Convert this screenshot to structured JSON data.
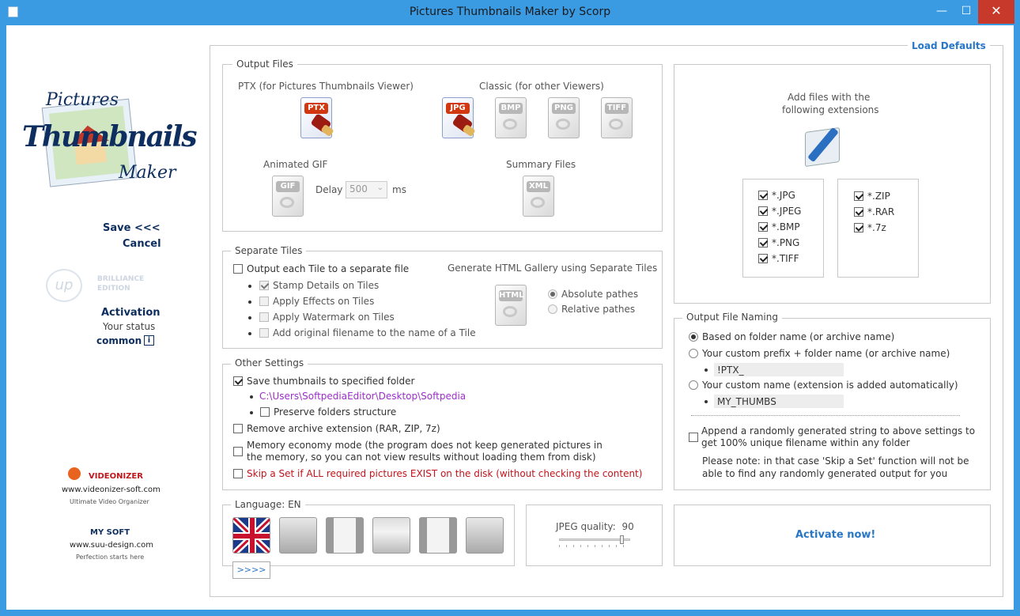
{
  "window": {
    "title": "Pictures Thumbnails Maker by Scorp",
    "min": "—",
    "max": "☐",
    "close": "✕"
  },
  "sidebar": {
    "logo_line1": "Pictures",
    "logo_line2": "Thumbnails",
    "logo_line3": "Maker",
    "save": "Save <<<",
    "cancel": "Cancel",
    "brilliance_line1": "BRILLIANCE",
    "brilliance_line2": "EDITION",
    "activation": "Activation",
    "your_status": "Your status",
    "status_value": "common",
    "videonizer": {
      "name": "VIDEONIZER",
      "url": "www.videonizer-soft.com",
      "tagline": "Ultimate Video Organizer"
    },
    "mysoft": {
      "name": "MY SOFT",
      "url": "www.suu-design.com",
      "tagline": "Perfection starts here"
    }
  },
  "load_defaults": "Load Defaults",
  "output_files": {
    "legend": "Output Files",
    "ptx_label": "PTX (for Pictures Thumbnails Viewer)",
    "classic_label": "Classic (for other Viewers)",
    "icons": [
      "PTX",
      "JPG",
      "BMP",
      "PNG",
      "TIFF"
    ],
    "animated_gif": "Animated GIF",
    "gif_icon": "GIF",
    "delay_label": "Delay",
    "delay_value": "500",
    "delay_unit": "ms",
    "summary_files": "Summary Files",
    "xml_icon": "XML"
  },
  "extensions": {
    "title_line1": "Add files with the",
    "title_line2": "following extensions",
    "left": [
      {
        "label": "*.JPG",
        "checked": true
      },
      {
        "label": "*.JPEG",
        "checked": true
      },
      {
        "label": "*.BMP",
        "checked": true
      },
      {
        "label": "*.PNG",
        "checked": true
      },
      {
        "label": "*.TIFF",
        "checked": true
      }
    ],
    "right": [
      {
        "label": "*.ZIP",
        "checked": true
      },
      {
        "label": "*.RAR",
        "checked": true
      },
      {
        "label": "*.7z",
        "checked": true
      }
    ]
  },
  "separate_tiles": {
    "legend": "Separate Tiles",
    "output_each": "Output each Tile to a separate file",
    "stamp_details": "Stamp Details on Tiles",
    "apply_effects": "Apply Effects on Tiles",
    "apply_watermark": "Apply Watermark on Tiles",
    "add_filename": "Add original filename to the name of a Tile",
    "gallery_title": "Generate HTML Gallery using Separate Tiles",
    "html_icon": "HTML",
    "absolute": "Absolute pathes",
    "relative": "Relative pathes"
  },
  "other_settings": {
    "legend": "Other Settings",
    "save_to_folder": "Save thumbnails to specified folder",
    "folder_path": "C:\\Users\\SoftpediaEditor\\Desktop\\Softpedia",
    "preserve_structure": "Preserve folders structure",
    "remove_ext": "Remove archive extension (RAR, ZIP, 7z)",
    "memory_line1": "Memory economy mode (the program does not keep generated pictures in",
    "memory_line2": "the memory, so you can not view results without loading them from disk)",
    "skip_set": "Skip a Set if ALL required pictures EXIST on the disk (without checking the content)"
  },
  "naming": {
    "legend": "Output File Naming",
    "opt1": "Based on folder name (or archive name)",
    "opt2": "Your custom prefix + folder name (or archive name)",
    "prefix_value": "!PTX_",
    "opt3": "Your custom name (extension is added automatically)",
    "name_value": "MY_THUMBS",
    "append_line1": "Append a randomly generated string to above settings to",
    "append_line2": "get 100% unique filename within any folder",
    "note_line1": "Please note: in that case 'Skip a Set' function will not be",
    "note_line2": "able to find any randomly generated output for you"
  },
  "language": {
    "legend": "Language: EN",
    "more": ">>>>"
  },
  "jpeg": {
    "label": "JPEG quality:",
    "value": "90",
    "quality_fraction": 0.9
  },
  "activate_now": "Activate now!"
}
